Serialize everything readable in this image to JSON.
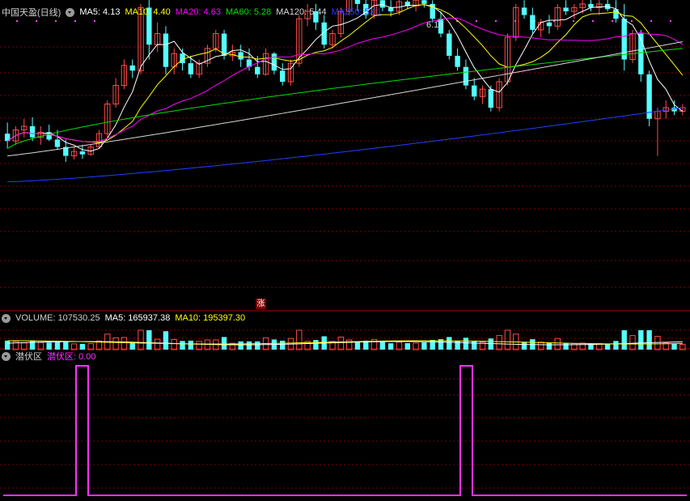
{
  "colors": {
    "up": "#ff4a4a",
    "down": "#54ffff",
    "grid": "#7a0000",
    "ma5": "#ffffff",
    "ma10": "#ffff00",
    "ma20": "#ff00ff",
    "ma60": "#00e000",
    "ma120": "#d8d8d8",
    "ma250": "#2040ff",
    "signal": "#ff30ff"
  },
  "price_panel": {
    "title": "中国天盈(日线)",
    "items": [
      {
        "label": "MA5: 4.13",
        "color": "#ffffff"
      },
      {
        "label": "MA10: 4.40",
        "color": "#ffff00"
      },
      {
        "label": "MA20: 4.63",
        "color": "#ff00ff"
      },
      {
        "label": "MA60: 5.28",
        "color": "#00e000"
      },
      {
        "label": "MA120: 5.44",
        "color": "#d8d8d8"
      },
      {
        "label": "MA250: 5.01",
        "color": "#2040ff"
      }
    ],
    "peak_label": "6.18",
    "marker": "涨"
  },
  "volume_panel": {
    "label": "VOLUME: 107530.25",
    "items": [
      {
        "label": "MA5: 165937.38",
        "color": "#ffffff"
      },
      {
        "label": "MA10: 195397.30",
        "color": "#ffff00"
      }
    ]
  },
  "indicator_panel": {
    "title": "潜伏区",
    "value_label": "潜伏区: 0.00"
  },
  "chart_data": [
    {
      "type": "candlestick",
      "title": "中国天盈(日线)",
      "ylim": [
        3.0,
        6.8
      ],
      "candles": [
        [
          4.2,
          4.35,
          4.0,
          4.1
        ],
        [
          4.1,
          4.3,
          4.05,
          4.25
        ],
        [
          4.25,
          4.4,
          4.15,
          4.3
        ],
        [
          4.3,
          4.42,
          4.1,
          4.15
        ],
        [
          4.15,
          4.3,
          4.05,
          4.22
        ],
        [
          4.22,
          4.32,
          4.1,
          4.12
        ],
        [
          4.12,
          4.25,
          3.98,
          4.02
        ],
        [
          4.02,
          4.12,
          3.82,
          3.9
        ],
        [
          3.9,
          4.02,
          3.85,
          3.96
        ],
        [
          3.96,
          4.05,
          3.86,
          3.92
        ],
        [
          3.92,
          4.05,
          3.9,
          4.02
        ],
        [
          4.02,
          4.25,
          4.0,
          4.2
        ],
        [
          4.2,
          4.65,
          4.15,
          4.6
        ],
        [
          4.6,
          4.95,
          4.55,
          4.85
        ],
        [
          4.85,
          5.2,
          4.8,
          5.12
        ],
        [
          5.12,
          5.2,
          4.95,
          5.05
        ],
        [
          5.05,
          5.95,
          5.0,
          5.9
        ],
        [
          5.9,
          6.05,
          5.2,
          5.4
        ],
        [
          5.4,
          5.7,
          5.3,
          5.55
        ],
        [
          5.55,
          5.65,
          5.0,
          5.1
        ],
        [
          5.1,
          5.35,
          5.0,
          5.28
        ],
        [
          5.28,
          5.35,
          5.05,
          5.15
        ],
        [
          5.15,
          5.25,
          4.95,
          5.0
        ],
        [
          5.0,
          5.2,
          4.95,
          5.15
        ],
        [
          5.15,
          5.4,
          5.1,
          5.35
        ],
        [
          5.35,
          5.6,
          5.3,
          5.55
        ],
        [
          5.55,
          5.6,
          5.2,
          5.25
        ],
        [
          5.25,
          5.4,
          5.18,
          5.3
        ],
        [
          5.3,
          5.4,
          5.1,
          5.2
        ],
        [
          5.2,
          5.35,
          5.05,
          5.1
        ],
        [
          5.1,
          5.25,
          4.95,
          5.0
        ],
        [
          5.0,
          5.35,
          4.98,
          5.28
        ],
        [
          5.28,
          5.3,
          5.0,
          5.05
        ],
        [
          5.05,
          5.15,
          4.85,
          4.9
        ],
        [
          4.9,
          5.2,
          4.85,
          5.15
        ],
        [
          5.15,
          5.8,
          5.1,
          5.75
        ],
        [
          5.75,
          5.95,
          5.65,
          5.85
        ],
        [
          5.85,
          5.95,
          5.6,
          5.7
        ],
        [
          5.7,
          5.8,
          5.35,
          5.4
        ],
        [
          5.4,
          5.6,
          5.35,
          5.55
        ],
        [
          5.55,
          5.9,
          5.5,
          5.85
        ],
        [
          5.85,
          6.1,
          5.8,
          6.05
        ],
        [
          6.05,
          6.1,
          5.85,
          5.95
        ],
        [
          5.95,
          6.05,
          5.75,
          5.8
        ],
        [
          5.8,
          6.08,
          5.75,
          6.0
        ],
        [
          6.0,
          6.12,
          5.85,
          5.9
        ],
        [
          5.9,
          6.0,
          5.78,
          5.85
        ],
        [
          5.85,
          6.02,
          5.8,
          5.98
        ],
        [
          5.98,
          6.1,
          5.88,
          5.92
        ],
        [
          5.92,
          6.05,
          5.85,
          6.0
        ],
        [
          6.0,
          6.18,
          5.9,
          5.95
        ],
        [
          5.95,
          6.0,
          5.7,
          5.75
        ],
        [
          5.75,
          5.85,
          5.5,
          5.55
        ],
        [
          5.55,
          5.6,
          5.2,
          5.25
        ],
        [
          5.25,
          5.35,
          5.05,
          5.1
        ],
        [
          5.1,
          5.2,
          4.8,
          4.85
        ],
        [
          4.85,
          4.95,
          4.65,
          4.7
        ],
        [
          4.7,
          4.85,
          4.6,
          4.8
        ],
        [
          4.8,
          4.85,
          4.5,
          4.55
        ],
        [
          4.55,
          4.95,
          4.5,
          4.9
        ],
        [
          4.9,
          5.55,
          4.85,
          5.5
        ],
        [
          5.5,
          5.95,
          5.45,
          5.9
        ],
        [
          5.9,
          6.0,
          5.75,
          5.8
        ],
        [
          5.8,
          5.9,
          5.55,
          5.6
        ],
        [
          5.6,
          5.75,
          5.5,
          5.7
        ],
        [
          5.7,
          5.8,
          5.55,
          5.65
        ],
        [
          5.65,
          5.95,
          5.6,
          5.9
        ],
        [
          5.9,
          6.0,
          5.8,
          5.85
        ],
        [
          5.85,
          5.95,
          5.75,
          5.9
        ],
        [
          5.9,
          6.05,
          5.82,
          5.95
        ],
        [
          5.95,
          6.05,
          5.85,
          5.9
        ],
        [
          5.9,
          6.0,
          5.8,
          5.95
        ],
        [
          5.95,
          6.02,
          5.85,
          5.88
        ],
        [
          5.88,
          6.0,
          5.7,
          5.75
        ],
        [
          5.75,
          5.95,
          5.05,
          5.2
        ],
        [
          5.2,
          5.6,
          5.15,
          5.55
        ],
        [
          5.55,
          5.6,
          4.9,
          5.0
        ],
        [
          5.0,
          5.05,
          4.3,
          4.4
        ],
        [
          4.4,
          4.55,
          3.9,
          4.5
        ],
        [
          4.5,
          4.65,
          4.4,
          4.55
        ],
        [
          4.55,
          4.65,
          4.45,
          4.5
        ],
        [
          4.5,
          4.6,
          4.45,
          4.55
        ]
      ],
      "ma_values": {
        "MA5": 4.13,
        "MA10": 4.4,
        "MA20": 4.63,
        "MA60": 5.28,
        "MA120": 5.44,
        "MA250": 5.01
      }
    },
    {
      "type": "bar",
      "title": "VOLUME",
      "values": [
        107530.25,
        165937.38,
        195397.3
      ],
      "series": [
        {
          "name": "VOLUME",
          "values": [
            107530.25
          ]
        },
        {
          "name": "MA5",
          "values": [
            165937.38
          ]
        },
        {
          "name": "MA10",
          "values": [
            195397.3
          ]
        }
      ]
    },
    {
      "type": "line",
      "title": "潜伏区",
      "series": [
        {
          "name": "潜伏区",
          "values": [
            0,
            0,
            0,
            0,
            0,
            0,
            0,
            0,
            0,
            0,
            0,
            0,
            0,
            0,
            0,
            0,
            0,
            0,
            1,
            1,
            1,
            0,
            0,
            0,
            0,
            0,
            0,
            0,
            0,
            0,
            0,
            0,
            0,
            0,
            0,
            0,
            0,
            0,
            0,
            0,
            0,
            0,
            0,
            0,
            0,
            0,
            0,
            0,
            0,
            0,
            0,
            0,
            0,
            0,
            0,
            0,
            0,
            0,
            0,
            0,
            0,
            0,
            0,
            0,
            0,
            0,
            0,
            0,
            0,
            0,
            0,
            0,
            0,
            0,
            0,
            0,
            0,
            0,
            0,
            0,
            0,
            0,
            0,
            0,
            0,
            0,
            0,
            0,
            0,
            0,
            0,
            0,
            0,
            0,
            0,
            0,
            0,
            0,
            0,
            0,
            0,
            0,
            0,
            0,
            0,
            0,
            0,
            0,
            0,
            0,
            0,
            0,
            0,
            1,
            1,
            1,
            0,
            0,
            0,
            0,
            0,
            0,
            0,
            0,
            0,
            0,
            0,
            0,
            0,
            0,
            0,
            0,
            0,
            0,
            0,
            0,
            0,
            0,
            0,
            0,
            0,
            0,
            0,
            0,
            0,
            0,
            0,
            0,
            0,
            0,
            0,
            0,
            0,
            0,
            0,
            0,
            0,
            0,
            0,
            0,
            0,
            0,
            0,
            0,
            0,
            0,
            0,
            0,
            0
          ]
        }
      ],
      "ylim": [
        0,
        1
      ]
    }
  ]
}
